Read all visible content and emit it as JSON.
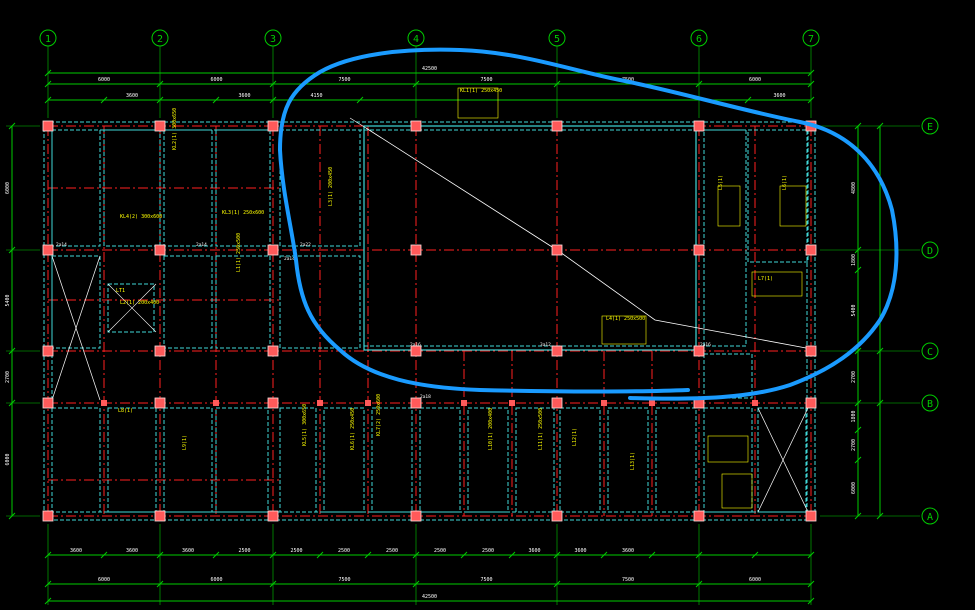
{
  "colors": {
    "background": "#000000",
    "grid_axis": "#00cc00",
    "beam_red": "#ff2020",
    "wall_cyan": "#40d8d8",
    "annotation_yellow": "#ffff00",
    "column_fill": "#ff5a5a",
    "column_stroke": "#ffe0e0",
    "markup_blue": "#1a9bff",
    "leader_white": "#ffffff",
    "text_white": "#ffffff"
  },
  "axes": {
    "vertical": [
      "1",
      "2",
      "3",
      "4",
      "5",
      "6",
      "7"
    ],
    "horizontal": [
      "E",
      "D",
      "C",
      "B",
      "A"
    ]
  },
  "dimensions": {
    "top_overall": "42500",
    "top_spans": [
      "6000",
      "6000",
      "7500",
      "7500",
      "7500",
      "6000"
    ],
    "top_sub": [
      "3600",
      "3600",
      "4150",
      "3600"
    ],
    "bottom_spans": [
      "3600",
      "3600",
      "3600",
      "2500",
      "2500",
      "2500",
      "2500",
      "2500",
      "2500",
      "3600",
      "3600",
      "3600"
    ],
    "bottom_axis": [
      "6000",
      "6000",
      "7500",
      "7500",
      "7500",
      "6000"
    ],
    "bottom_overall": "42500",
    "left_levels": [
      "6000",
      "5400",
      "2700",
      "6000"
    ],
    "right_levels": [
      "4800",
      "1800",
      "5400",
      "2700",
      "1800",
      "2700",
      "6000"
    ]
  },
  "annotations": {
    "beam_tags": [
      "KL1(1) 250x450",
      "KL2(1) 300x650",
      "KL3(1) 250x600",
      "KL4(2) 300x600",
      "L1(1) 250x500",
      "L2(1) 200x400",
      "L3(1) 200x450",
      "L4(1) 250x500",
      "L5(1)",
      "L6(1)",
      "L7(1)",
      "L8(1)",
      "L9(1)",
      "KL5(1) 300x650",
      "KL6(1) 250x450",
      "KL7(2) 250x600",
      "L10(1) 200x400",
      "L11(1) 250x500",
      "L12(1)",
      "L13(1)"
    ],
    "bar_tags": [
      "2a14",
      "2a14",
      "2a14",
      "2a22",
      "2a16",
      "3a12",
      "2a16",
      "2a18"
    ],
    "stair_label": "LT1"
  }
}
